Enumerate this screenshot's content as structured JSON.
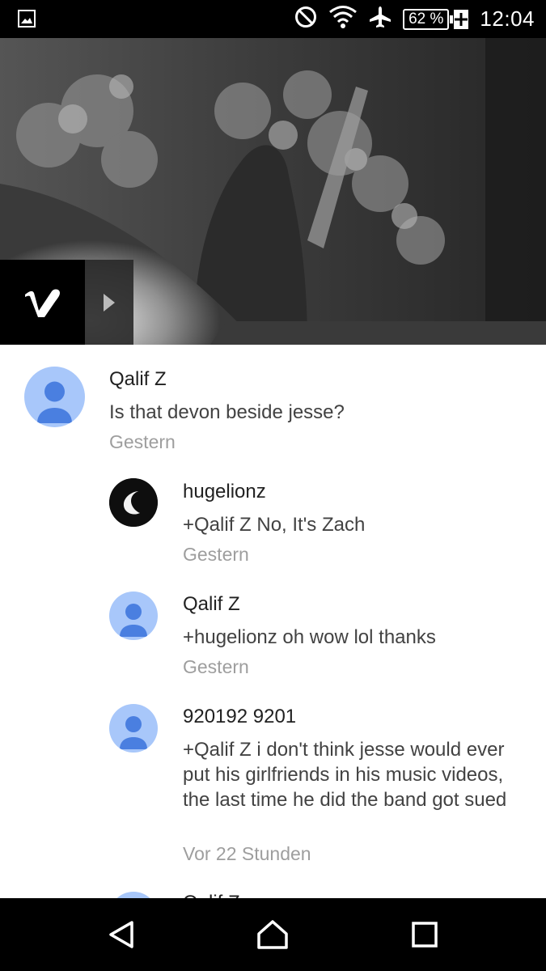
{
  "status_bar": {
    "battery_percent": "62 %",
    "time": "12:04",
    "icons": [
      "image-notification-icon",
      "do-not-disturb-icon",
      "wifi-icon",
      "airplane-mode-icon",
      "battery-charging-icon"
    ]
  },
  "video": {
    "provider_logo": "vimeo-logo",
    "play_icon": "play-icon"
  },
  "comments": [
    {
      "author": "Qalif Z",
      "text": "Is that devon beside jesse?",
      "time": "Gestern",
      "avatar": "default-avatar"
    },
    {
      "author": "hugelionz",
      "text": "+Qalif Z No, It's Zach",
      "time": "Gestern",
      "avatar": "moon-avatar"
    },
    {
      "author": "Qalif Z",
      "text": "+hugelionz oh wow lol thanks",
      "time": "Gestern",
      "avatar": "default-avatar"
    },
    {
      "author": "920192 9201",
      "text": "+Qalif Z i don't think jesse would ever put his girlfriends in his music videos, the last time he did the band got sued",
      "time": "Vor 22 Stunden",
      "avatar": "default-avatar"
    },
    {
      "author": "Qalif Z",
      "text": "",
      "time": "",
      "avatar": "default-avatar"
    }
  ],
  "colors": {
    "avatar_bg": "#a8c7fa",
    "avatar_fg": "#4a7fe0"
  },
  "nav_bar": {
    "icons": [
      "back-icon",
      "home-icon",
      "recents-icon"
    ]
  }
}
